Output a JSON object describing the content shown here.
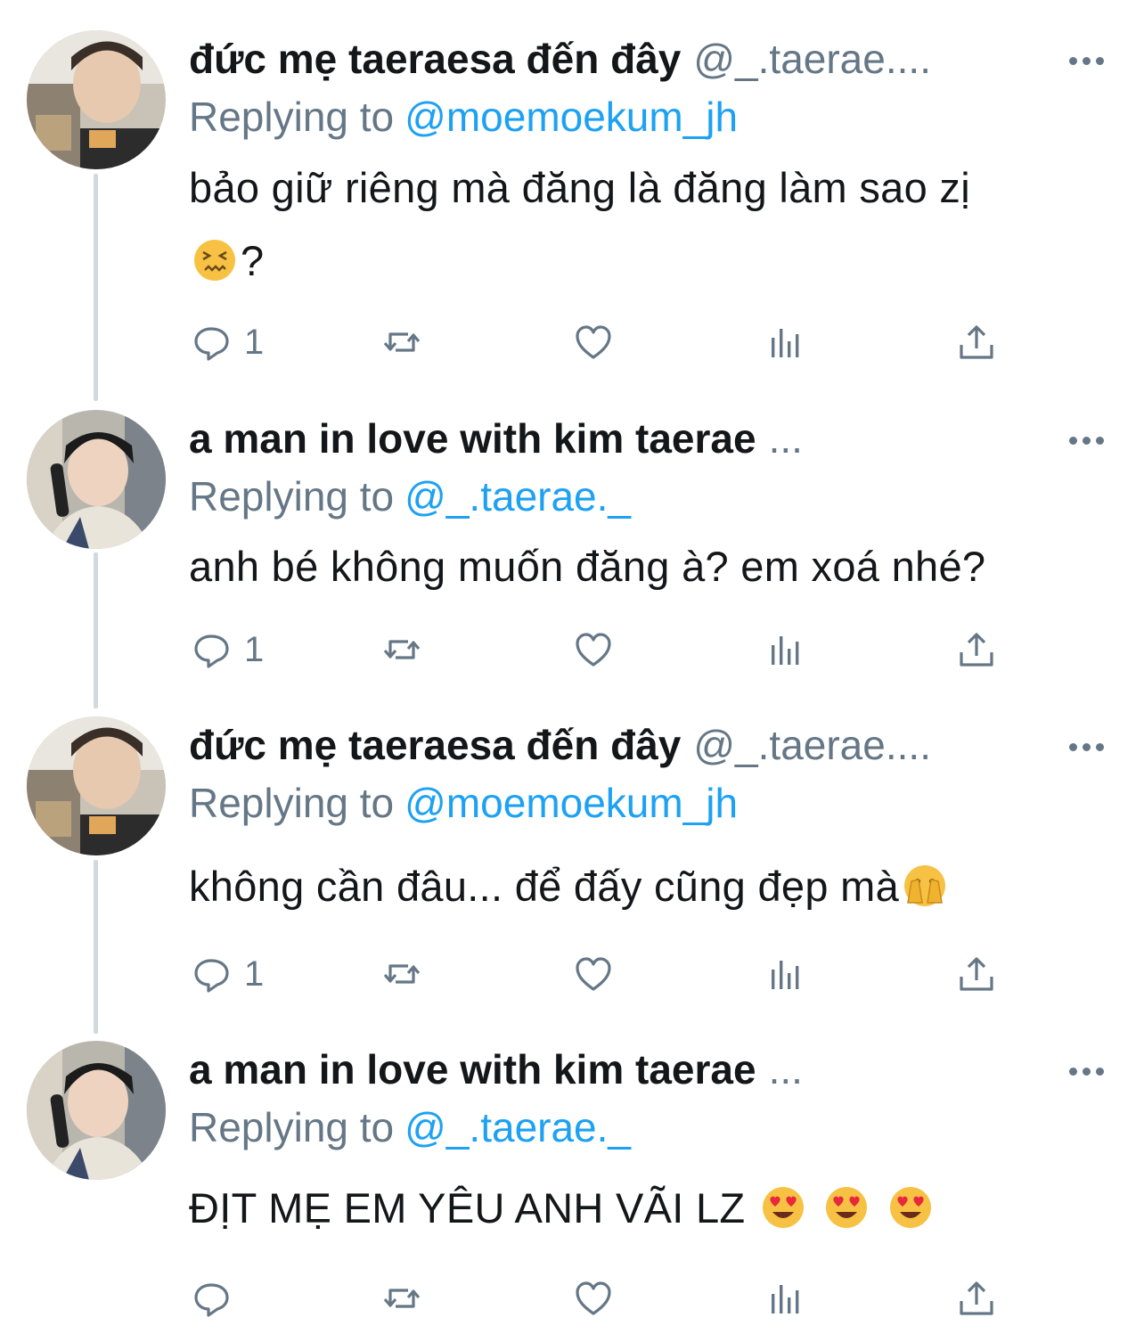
{
  "colors": {
    "link": "#1da1f2",
    "muted": "#657786",
    "text": "#14171a",
    "thread": "#cfd9de"
  },
  "tweets": [
    {
      "name": "đức mẹ taeraesa đến đây",
      "handle": "@_.taerae....",
      "reply_prefix": "Replying to",
      "reply_to": "@moemoekum_jh",
      "text_line1": "bảo giữ riêng mà đăng là đăng làm sao zị",
      "text_line2": "?",
      "emoji": "confounded-face",
      "reply_count": "1"
    },
    {
      "name": "a man in love with kim taerae",
      "handle": "...",
      "reply_prefix": "Replying to",
      "reply_to": "@_.taerae._",
      "text_line1": "anh bé không muốn đăng à? em xoá nhé?",
      "reply_count": "1"
    },
    {
      "name": "đức mẹ taeraesa đến đây",
      "handle": "@_.taerae....",
      "reply_prefix": "Replying to",
      "reply_to": "@moemoekum_jh",
      "text_line1": "không cần đâu... để đấy cũng đẹp mà",
      "emoji": "face-with-open-eyes-and-hand-over-mouth",
      "reply_count": "1"
    },
    {
      "name": "a man in love with kim taerae",
      "handle": "...",
      "reply_prefix": "Replying to",
      "reply_to": "@_.taerae._",
      "text_line1": "ĐỊT MẸ EM YÊU ANH VÃI LZ",
      "emoji": "smiling-face-with-heart-eyes",
      "emoji_count": 3,
      "reply_count": ""
    }
  ],
  "icons": [
    "reply-icon",
    "retweet-icon",
    "like-icon",
    "stats-icon",
    "share-icon",
    "more-icon"
  ]
}
